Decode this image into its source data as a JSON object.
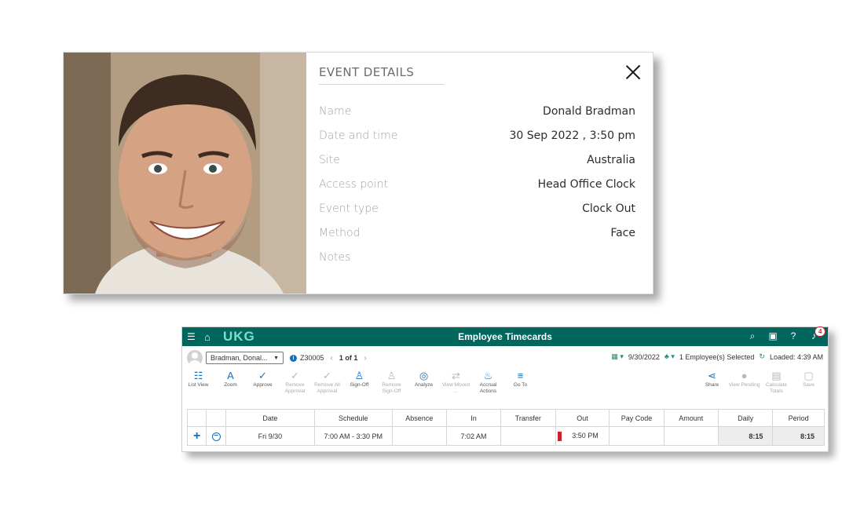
{
  "event_details": {
    "title": "EVENT DETAILS",
    "fields": [
      {
        "label": "Name",
        "value": "Donald Bradman"
      },
      {
        "label": "Date and time",
        "value": "30 Sep 2022 , 3:50 pm"
      },
      {
        "label": "Site",
        "value": "Australia"
      },
      {
        "label": "Access point",
        "value": "Head Office Clock"
      },
      {
        "label": "Event type",
        "value": "Clock Out"
      },
      {
        "label": "Method",
        "value": "Face"
      },
      {
        "label": "Notes",
        "value": ""
      }
    ]
  },
  "timecard": {
    "brand": "UKG",
    "title": "Employee Timecards",
    "notification_count": "4",
    "employee": "Bradman, Donal...",
    "employee_id": "Z30005",
    "pager": "1 of 1",
    "date": "9/30/2022",
    "employees_selected": "1 Employee(s) Selected",
    "loaded": "Loaded: 4:39 AM",
    "toolbar": [
      {
        "label": "List View",
        "icon": "list-icon"
      },
      {
        "label": "Zoom",
        "icon": "zoom-icon"
      },
      {
        "label": "Approve",
        "icon": "check-icon"
      },
      {
        "label": "Remove Approval",
        "icon": "remove-approval-icon"
      },
      {
        "label": "Remove All Approval",
        "icon": "remove-all-icon"
      },
      {
        "label": "Sign-Off",
        "icon": "sign-off-icon"
      },
      {
        "label": "Remove Sign-Off",
        "icon": "remove-sign-off-icon"
      },
      {
        "label": "Analyze",
        "icon": "analyze-icon"
      },
      {
        "label": "View Moved ...",
        "icon": "view-moved-icon"
      },
      {
        "label": "Accrual Actions",
        "icon": "accrual-icon"
      },
      {
        "label": "Go To",
        "icon": "goto-icon"
      }
    ],
    "toolbar_right": [
      {
        "label": "Share",
        "icon": "share-icon"
      },
      {
        "label": "View Pending",
        "icon": "view-pending-icon"
      },
      {
        "label": "Calculate Totals",
        "icon": "calculator-icon"
      },
      {
        "label": "Save",
        "icon": "save-icon"
      }
    ],
    "columns": [
      "Date",
      "Schedule",
      "Absence",
      "In",
      "Transfer",
      "Out",
      "Pay Code",
      "Amount",
      "Daily",
      "Period"
    ],
    "rows": [
      {
        "date": "Fri 9/30",
        "schedule": "7:00 AM - 3:30 PM",
        "absence": "",
        "in": "7:02 AM",
        "transfer": "",
        "out": "3:50 PM",
        "pay_code": "",
        "amount": "",
        "daily": "8:15",
        "period": "8:15"
      }
    ],
    "colors": {
      "header": "#00665e",
      "accent": "#1a6fb5",
      "alert": "#d21f2b"
    }
  }
}
